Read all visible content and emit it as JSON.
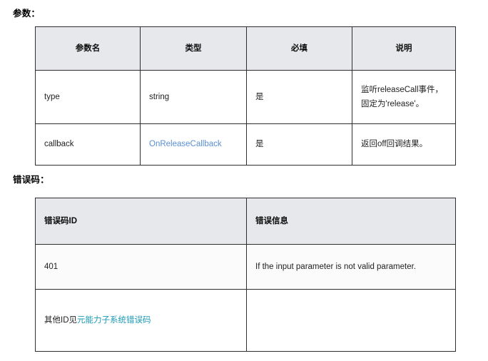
{
  "page": {
    "params_section_title": "参数：",
    "errors_section_title": "错误码："
  },
  "params_table": {
    "headers": [
      "参数名",
      "类型",
      "必填",
      "说明"
    ],
    "rows": [
      {
        "name": "type",
        "type": "string",
        "type_is_link": false,
        "required": "是",
        "description": "监听releaseCall事件，\n固定为'release'。"
      },
      {
        "name": "callback",
        "type": "OnReleaseCallback",
        "type_is_link": true,
        "required": "是",
        "description": "返回off回调结果。"
      }
    ]
  },
  "errors_table": {
    "headers": [
      "错误码ID",
      "错误信息"
    ],
    "rows": [
      {
        "id": "401",
        "id_prefix": "",
        "id_link": "",
        "message": "If the input parameter is not valid parameter."
      },
      {
        "id": "",
        "id_prefix": "其他ID见",
        "id_link": "元能力子系统错误码",
        "message": ""
      }
    ]
  },
  "colors": {
    "link_blue": "#5b8fce",
    "link_teal": "#1a9ab5",
    "header_bg": "#e6e8eb",
    "border": "#2e2e2e"
  }
}
